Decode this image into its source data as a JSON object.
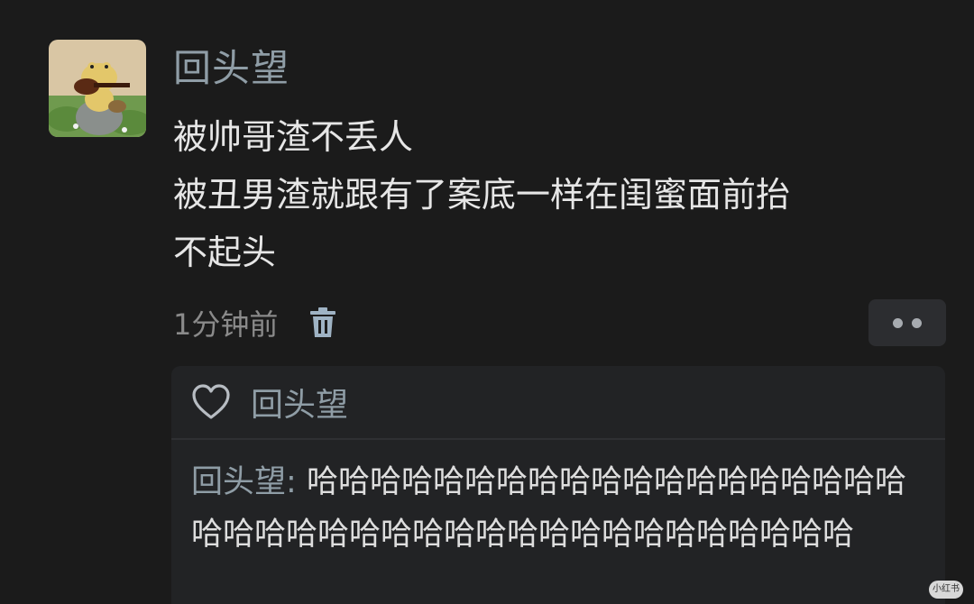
{
  "post": {
    "username": "回头望",
    "content_lines": [
      "被帅哥渣不丢人",
      "被丑男渣就跟有了案底一样在闺蜜面前抬",
      "不起头"
    ],
    "time": "1分钟前"
  },
  "icons": {
    "trash": "trash-icon",
    "more": "more-dots-icon",
    "heart": "heart-icon"
  },
  "likes": {
    "name": "回头望"
  },
  "reply": {
    "author": "回头望:",
    "text": "哈哈哈哈哈哈哈哈哈哈哈哈哈哈哈哈哈哈哈哈哈哈哈哈哈哈哈哈哈哈哈哈哈哈哈哈哈哈哈哈"
  },
  "watermark": "小红书",
  "colors": {
    "background": "#1b1b1b",
    "username": "#8f9da6",
    "text": "#e6e6e6",
    "muted": "#8a8a8a",
    "panel": "#222325"
  }
}
